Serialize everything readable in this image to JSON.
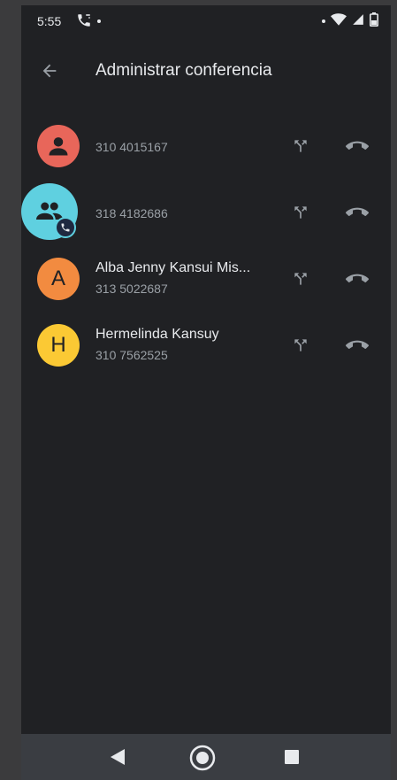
{
  "status_bar": {
    "time": "5:55"
  },
  "app_bar": {
    "title": "Administrar conferencia"
  },
  "participants": [
    {
      "name": "",
      "number": "310 4015167",
      "avatar_type": "person-icon",
      "avatar_color": "#e8665a"
    },
    {
      "name": "",
      "number": "318 4182686",
      "avatar_type": "group-icon",
      "avatar_color": "#5fd0e0"
    },
    {
      "name": "Alba Jenny Kansui Mis...",
      "number": "313 5022687",
      "avatar_letter": "A",
      "avatar_color": "#f28b40"
    },
    {
      "name": "Hermelinda Kansuy",
      "number": "310 7562525",
      "avatar_letter": "H",
      "avatar_color": "#fbc934"
    }
  ],
  "colors": {
    "background": "#202124",
    "text_primary": "#e8eaed",
    "text_secondary": "#9aa0a6",
    "nav_bar": "#3a3d42"
  }
}
